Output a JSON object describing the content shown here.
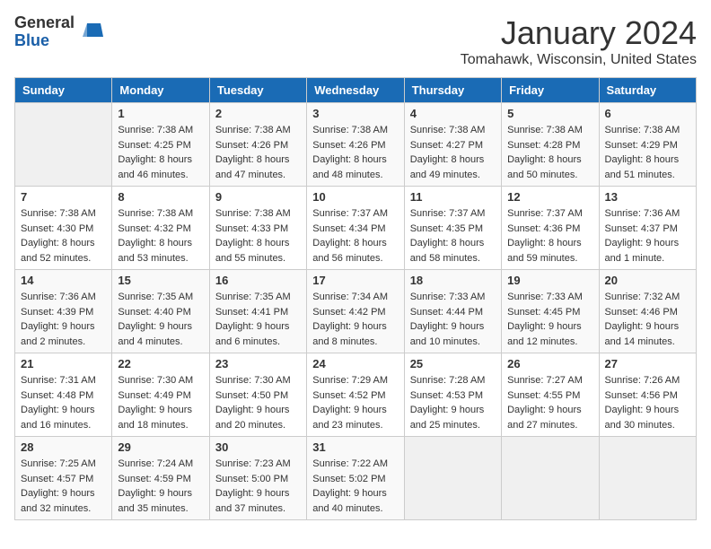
{
  "logo": {
    "general": "General",
    "blue": "Blue"
  },
  "title": "January 2024",
  "location": "Tomahawk, Wisconsin, United States",
  "weekdays": [
    "Sunday",
    "Monday",
    "Tuesday",
    "Wednesday",
    "Thursday",
    "Friday",
    "Saturday"
  ],
  "weeks": [
    [
      {
        "day": "",
        "sunrise": "",
        "sunset": "",
        "daylight": ""
      },
      {
        "day": "1",
        "sunrise": "Sunrise: 7:38 AM",
        "sunset": "Sunset: 4:25 PM",
        "daylight": "Daylight: 8 hours and 46 minutes."
      },
      {
        "day": "2",
        "sunrise": "Sunrise: 7:38 AM",
        "sunset": "Sunset: 4:26 PM",
        "daylight": "Daylight: 8 hours and 47 minutes."
      },
      {
        "day": "3",
        "sunrise": "Sunrise: 7:38 AM",
        "sunset": "Sunset: 4:26 PM",
        "daylight": "Daylight: 8 hours and 48 minutes."
      },
      {
        "day": "4",
        "sunrise": "Sunrise: 7:38 AM",
        "sunset": "Sunset: 4:27 PM",
        "daylight": "Daylight: 8 hours and 49 minutes."
      },
      {
        "day": "5",
        "sunrise": "Sunrise: 7:38 AM",
        "sunset": "Sunset: 4:28 PM",
        "daylight": "Daylight: 8 hours and 50 minutes."
      },
      {
        "day": "6",
        "sunrise": "Sunrise: 7:38 AM",
        "sunset": "Sunset: 4:29 PM",
        "daylight": "Daylight: 8 hours and 51 minutes."
      }
    ],
    [
      {
        "day": "7",
        "sunrise": "Sunrise: 7:38 AM",
        "sunset": "Sunset: 4:30 PM",
        "daylight": "Daylight: 8 hours and 52 minutes."
      },
      {
        "day": "8",
        "sunrise": "Sunrise: 7:38 AM",
        "sunset": "Sunset: 4:32 PM",
        "daylight": "Daylight: 8 hours and 53 minutes."
      },
      {
        "day": "9",
        "sunrise": "Sunrise: 7:38 AM",
        "sunset": "Sunset: 4:33 PM",
        "daylight": "Daylight: 8 hours and 55 minutes."
      },
      {
        "day": "10",
        "sunrise": "Sunrise: 7:37 AM",
        "sunset": "Sunset: 4:34 PM",
        "daylight": "Daylight: 8 hours and 56 minutes."
      },
      {
        "day": "11",
        "sunrise": "Sunrise: 7:37 AM",
        "sunset": "Sunset: 4:35 PM",
        "daylight": "Daylight: 8 hours and 58 minutes."
      },
      {
        "day": "12",
        "sunrise": "Sunrise: 7:37 AM",
        "sunset": "Sunset: 4:36 PM",
        "daylight": "Daylight: 8 hours and 59 minutes."
      },
      {
        "day": "13",
        "sunrise": "Sunrise: 7:36 AM",
        "sunset": "Sunset: 4:37 PM",
        "daylight": "Daylight: 9 hours and 1 minute."
      }
    ],
    [
      {
        "day": "14",
        "sunrise": "Sunrise: 7:36 AM",
        "sunset": "Sunset: 4:39 PM",
        "daylight": "Daylight: 9 hours and 2 minutes."
      },
      {
        "day": "15",
        "sunrise": "Sunrise: 7:35 AM",
        "sunset": "Sunset: 4:40 PM",
        "daylight": "Daylight: 9 hours and 4 minutes."
      },
      {
        "day": "16",
        "sunrise": "Sunrise: 7:35 AM",
        "sunset": "Sunset: 4:41 PM",
        "daylight": "Daylight: 9 hours and 6 minutes."
      },
      {
        "day": "17",
        "sunrise": "Sunrise: 7:34 AM",
        "sunset": "Sunset: 4:42 PM",
        "daylight": "Daylight: 9 hours and 8 minutes."
      },
      {
        "day": "18",
        "sunrise": "Sunrise: 7:33 AM",
        "sunset": "Sunset: 4:44 PM",
        "daylight": "Daylight: 9 hours and 10 minutes."
      },
      {
        "day": "19",
        "sunrise": "Sunrise: 7:33 AM",
        "sunset": "Sunset: 4:45 PM",
        "daylight": "Daylight: 9 hours and 12 minutes."
      },
      {
        "day": "20",
        "sunrise": "Sunrise: 7:32 AM",
        "sunset": "Sunset: 4:46 PM",
        "daylight": "Daylight: 9 hours and 14 minutes."
      }
    ],
    [
      {
        "day": "21",
        "sunrise": "Sunrise: 7:31 AM",
        "sunset": "Sunset: 4:48 PM",
        "daylight": "Daylight: 9 hours and 16 minutes."
      },
      {
        "day": "22",
        "sunrise": "Sunrise: 7:30 AM",
        "sunset": "Sunset: 4:49 PM",
        "daylight": "Daylight: 9 hours and 18 minutes."
      },
      {
        "day": "23",
        "sunrise": "Sunrise: 7:30 AM",
        "sunset": "Sunset: 4:50 PM",
        "daylight": "Daylight: 9 hours and 20 minutes."
      },
      {
        "day": "24",
        "sunrise": "Sunrise: 7:29 AM",
        "sunset": "Sunset: 4:52 PM",
        "daylight": "Daylight: 9 hours and 23 minutes."
      },
      {
        "day": "25",
        "sunrise": "Sunrise: 7:28 AM",
        "sunset": "Sunset: 4:53 PM",
        "daylight": "Daylight: 9 hours and 25 minutes."
      },
      {
        "day": "26",
        "sunrise": "Sunrise: 7:27 AM",
        "sunset": "Sunset: 4:55 PM",
        "daylight": "Daylight: 9 hours and 27 minutes."
      },
      {
        "day": "27",
        "sunrise": "Sunrise: 7:26 AM",
        "sunset": "Sunset: 4:56 PM",
        "daylight": "Daylight: 9 hours and 30 minutes."
      }
    ],
    [
      {
        "day": "28",
        "sunrise": "Sunrise: 7:25 AM",
        "sunset": "Sunset: 4:57 PM",
        "daylight": "Daylight: 9 hours and 32 minutes."
      },
      {
        "day": "29",
        "sunrise": "Sunrise: 7:24 AM",
        "sunset": "Sunset: 4:59 PM",
        "daylight": "Daylight: 9 hours and 35 minutes."
      },
      {
        "day": "30",
        "sunrise": "Sunrise: 7:23 AM",
        "sunset": "Sunset: 5:00 PM",
        "daylight": "Daylight: 9 hours and 37 minutes."
      },
      {
        "day": "31",
        "sunrise": "Sunrise: 7:22 AM",
        "sunset": "Sunset: 5:02 PM",
        "daylight": "Daylight: 9 hours and 40 minutes."
      },
      {
        "day": "",
        "sunrise": "",
        "sunset": "",
        "daylight": ""
      },
      {
        "day": "",
        "sunrise": "",
        "sunset": "",
        "daylight": ""
      },
      {
        "day": "",
        "sunrise": "",
        "sunset": "",
        "daylight": ""
      }
    ]
  ]
}
